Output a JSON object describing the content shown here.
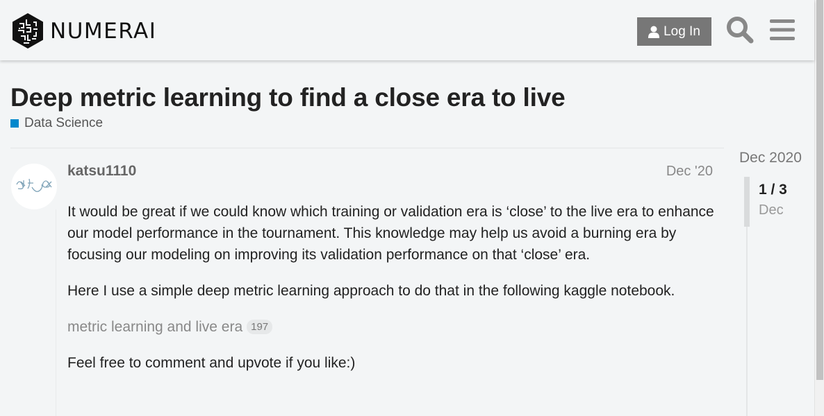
{
  "header": {
    "logo_text": "NUMERAI",
    "login_label": "Log In",
    "icons": {
      "user": "user-icon",
      "search": "search-icon",
      "menu": "hamburger-menu-icon"
    }
  },
  "topic": {
    "title": "Deep metric learning to find a close era to live",
    "category": {
      "name": "Data Science",
      "color": "#0088cc"
    }
  },
  "post": {
    "username": "katsu1110",
    "date": "Dec '20",
    "paragraphs": [
      "It would be great if we could know which training or validation era is ‘close’ to the live era to enhance our model performance in the tournament. This knowledge may help us avoid a burning era by focusing our modeling on improving its validation performance on that ‘close’ era.",
      "Here I use a simple deep metric learning approach to do that in the following kaggle notebook."
    ],
    "link": {
      "text": "metric learning and live era",
      "clicks": "197"
    },
    "closing": "Feel free to comment and upvote if you like:)"
  },
  "timeline": {
    "start_date": "Dec 2020",
    "position": "1 / 3",
    "current_date": "Dec"
  },
  "colors": {
    "accent": "#0088cc",
    "button_bg": "#777777",
    "page_bg": "#f3f5f6"
  }
}
